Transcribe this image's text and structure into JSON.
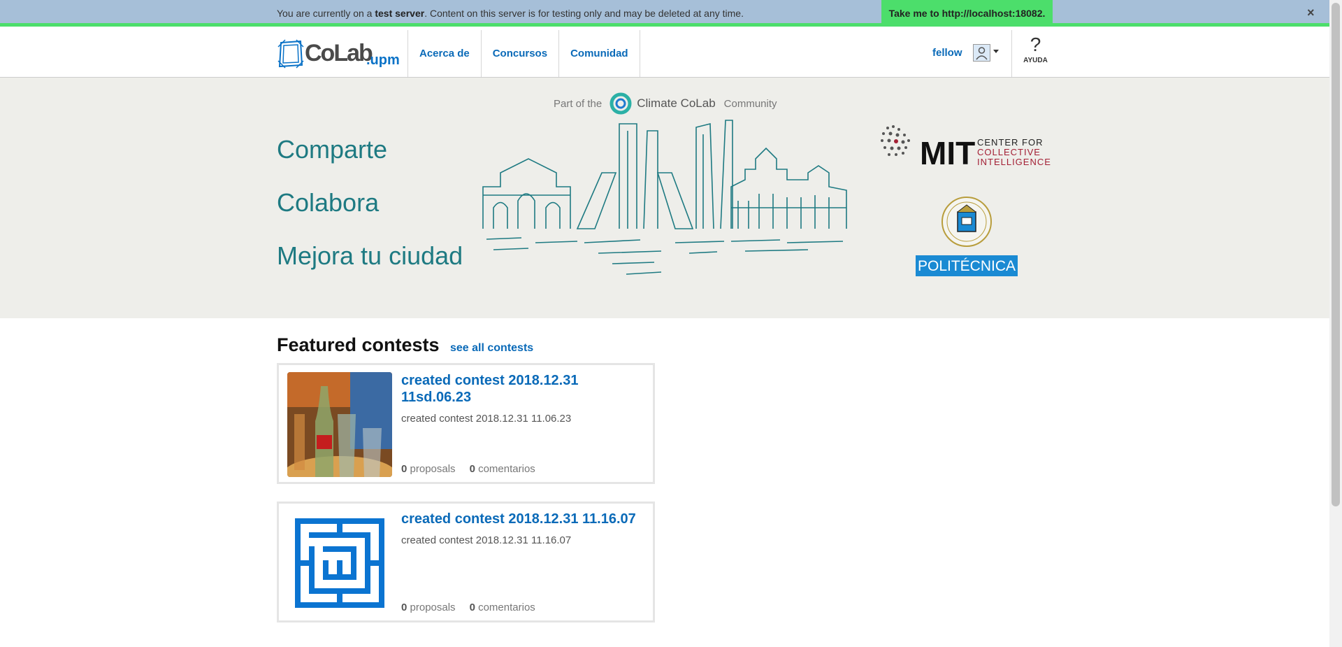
{
  "banner": {
    "prefix": "You are currently on a ",
    "bold": "test server",
    "suffix": ". Content on this server is for testing only and may be deleted at any time.",
    "button_label": "Take me to http://localhost:18082.",
    "close_label": "×"
  },
  "header": {
    "logo_text": "CoLab",
    "logo_suffix": ".upm",
    "nav": [
      "Acerca de",
      "Concursos",
      "Comunidad"
    ],
    "user_name": "fellow",
    "help_symbol": "?",
    "help_label": "AYUDA"
  },
  "hero": {
    "part_of_prefix": "Part of the",
    "climate_colab": "Climate CoLab",
    "part_of_suffix": "Community",
    "lines": [
      "Comparte",
      "Colabora",
      "Mejora tu ciudad"
    ],
    "mit_text": "MIT",
    "mit_sub": [
      "CENTER FOR",
      "COLLECTIVE",
      "INTELLIGENCE"
    ],
    "upm_text": "POLITÉCNICA"
  },
  "featured": {
    "title": "Featured contests",
    "see_all": "see all contests",
    "contests": [
      {
        "title": "created contest 2018.12.31 11sd.06.23",
        "description": "created contest 2018.12.31 11.06.23",
        "proposals_count": "0",
        "proposals_label": "proposals",
        "comments_count": "0",
        "comments_label": "comentarios"
      },
      {
        "title": "created contest 2018.12.31 11.16.07",
        "description": "created contest 2018.12.31 11.16.07",
        "proposals_count": "0",
        "proposals_label": "proposals",
        "comments_count": "0",
        "comments_label": "comentarios"
      }
    ]
  },
  "colors": {
    "banner_bg": "#a6bfd8",
    "banner_accent": "#4cde6b",
    "link": "#0a6ab8",
    "hero_text": "#1e7a82",
    "hero_bg": "#eeeeea"
  }
}
